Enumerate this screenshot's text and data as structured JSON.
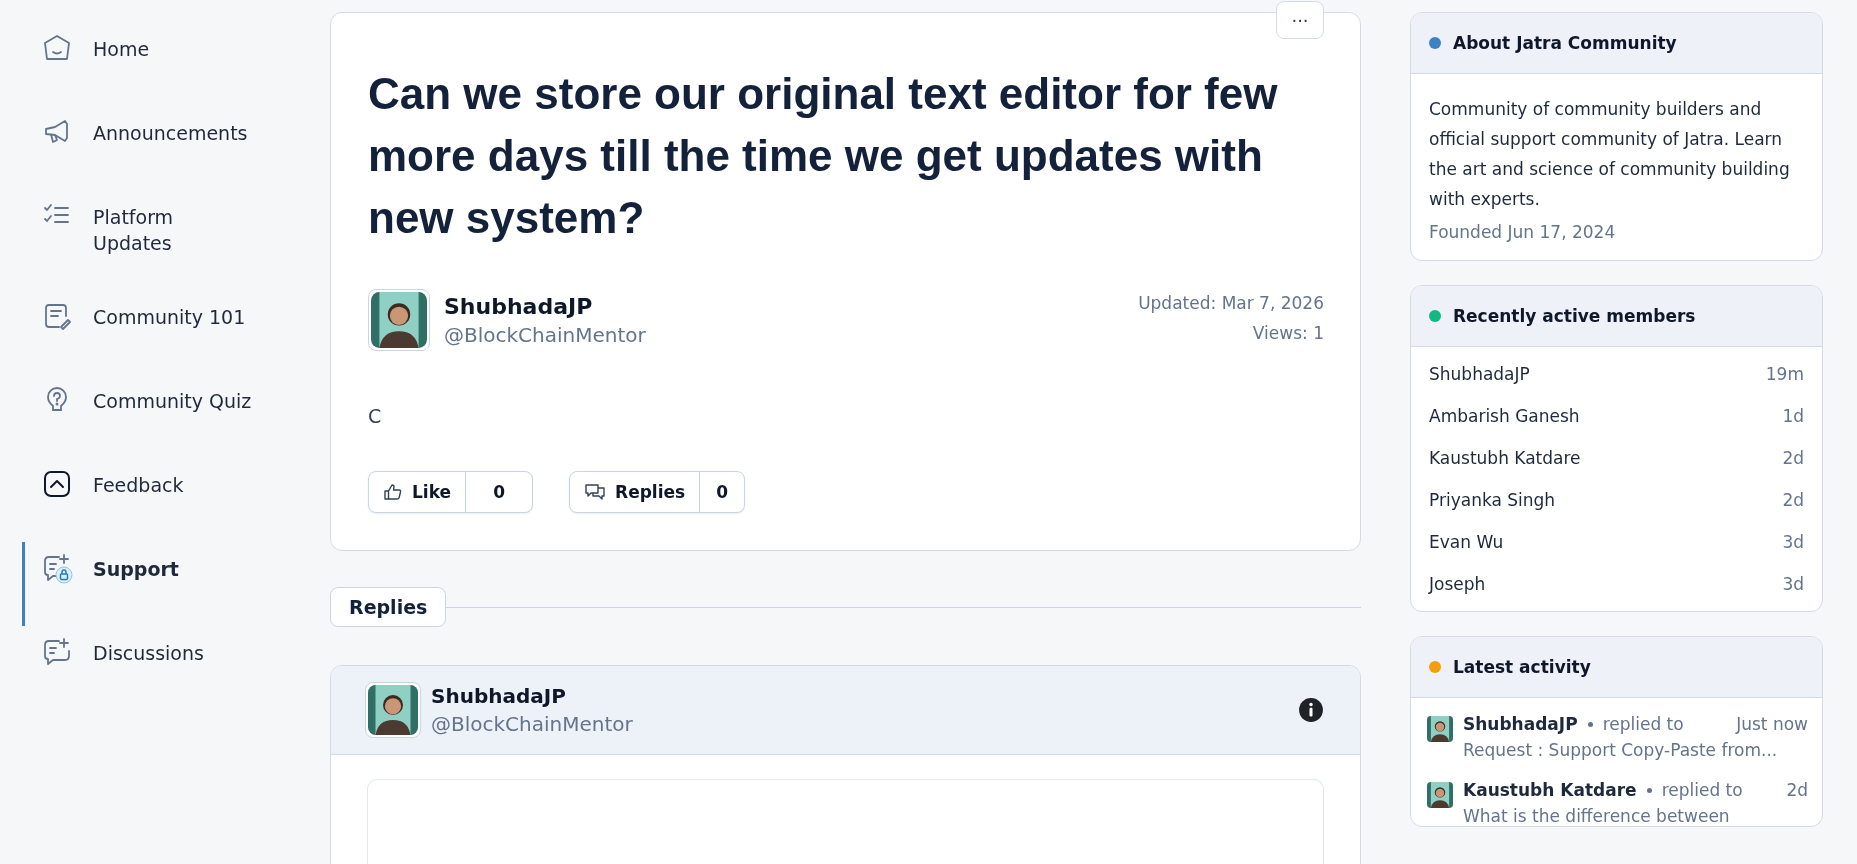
{
  "sidebar": {
    "items": [
      {
        "label": "Home",
        "selected": false
      },
      {
        "label": "Announcements",
        "selected": false
      },
      {
        "label": "Platform Updates",
        "selected": false
      },
      {
        "label": "Community 101",
        "selected": false
      },
      {
        "label": "Community Quiz",
        "selected": false
      },
      {
        "label": "Feedback",
        "selected": false
      },
      {
        "label": "Support",
        "selected": true
      },
      {
        "label": "Discussions",
        "selected": false
      }
    ]
  },
  "post": {
    "more": "···",
    "title": "Can we store our original text editor for few more days till the time we get updates with new system?",
    "author": "ShubhadaJP",
    "handle": "@BlockChainMentor",
    "updated": "Updated: Mar 7, 2026",
    "views": "Views: 1",
    "body": "C",
    "actions": [
      {
        "kind": "like",
        "label": "Like",
        "count": "0"
      },
      {
        "kind": "replies",
        "label": "Replies",
        "count": "0"
      }
    ]
  },
  "replies_tab": "Replies",
  "reply": {
    "author": "ShubhadaJP",
    "handle": "@BlockChainMentor"
  },
  "about": {
    "title": "About Jatra Community",
    "color": "#3b82c4",
    "description": "Community of community builders and official support community of Jatra. Learn the art and science of community building with experts.",
    "founded": "Founded Jun 17, 2024"
  },
  "members": {
    "title": "Recently active members",
    "color": "#10b981",
    "rows": [
      {
        "name": "ShubhadaJP",
        "time": "19m"
      },
      {
        "name": "Ambarish Ganesh",
        "time": "1d"
      },
      {
        "name": "Kaustubh Katdare",
        "time": "2d"
      },
      {
        "name": "Priyanka Singh",
        "time": "2d"
      },
      {
        "name": "Evan Wu",
        "time": "3d"
      },
      {
        "name": "Joseph",
        "time": "3d"
      }
    ]
  },
  "activity": {
    "title": "Latest activity",
    "color": "#f59e0b",
    "items": [
      {
        "name": "ShubhadaJP",
        "action": "replied to",
        "time": "Just now",
        "snippet": "Request : Support Copy-Paste from..."
      },
      {
        "name": "Kaustubh Katdare",
        "action": "replied to",
        "time": "2d",
        "snippet": "What is the difference between"
      }
    ]
  }
}
